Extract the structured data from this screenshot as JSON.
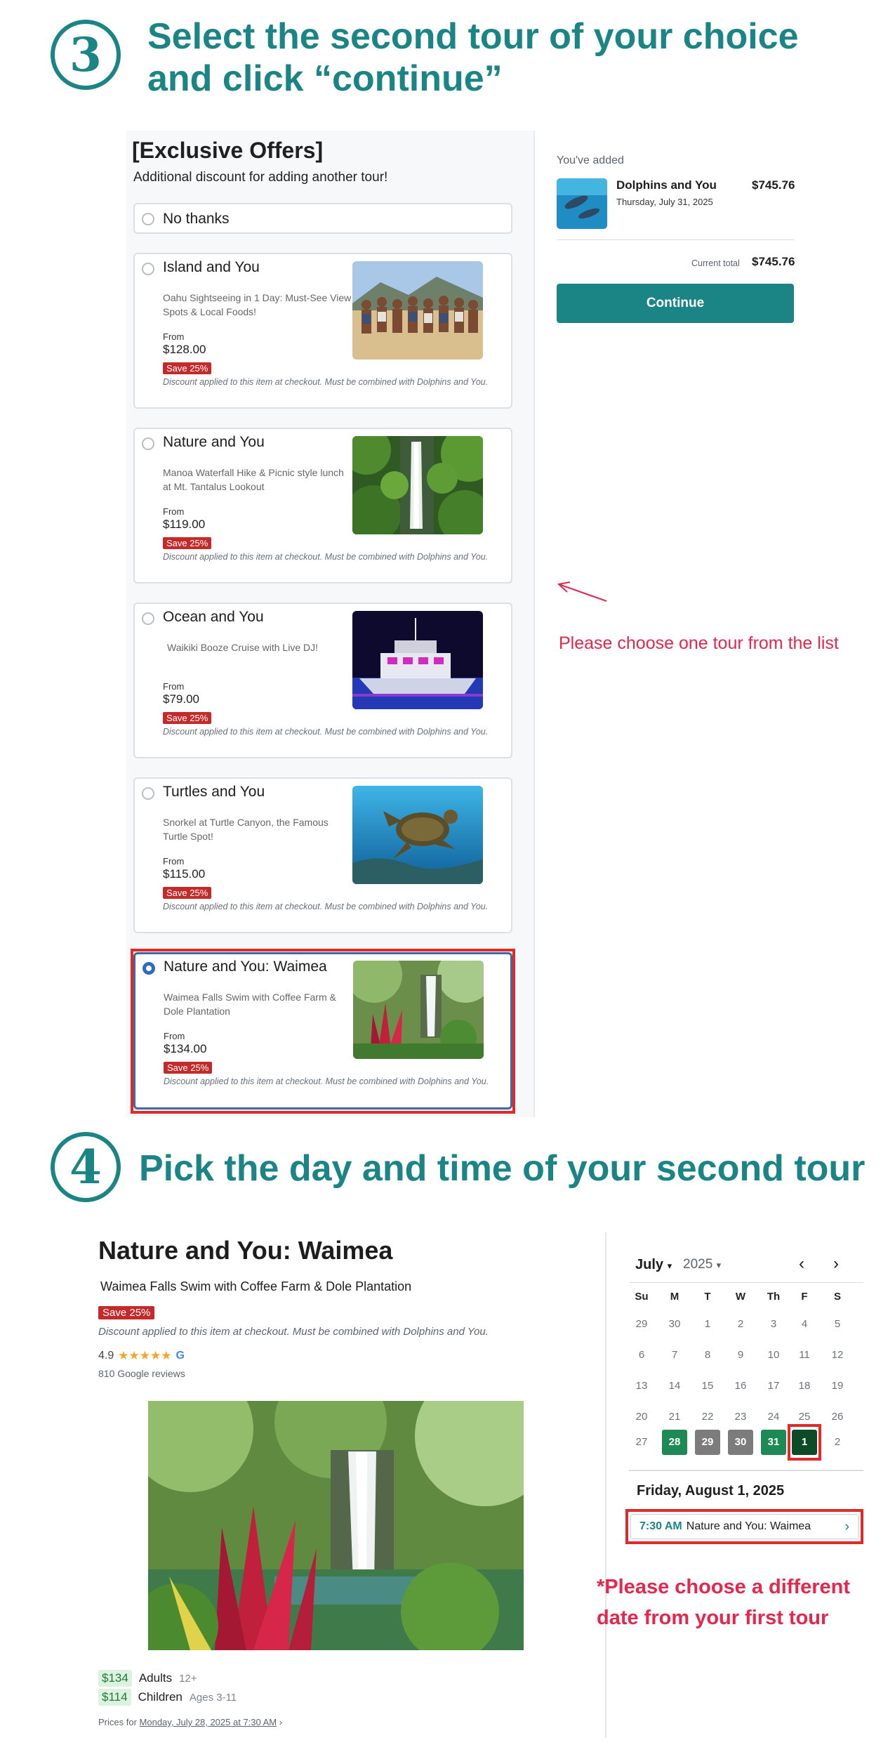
{
  "step3": {
    "number": "3",
    "title_line1": "Select the second tour of your choice",
    "title_line2": "and click “continue”"
  },
  "offers": {
    "heading": "[Exclusive Offers]",
    "subheading": "Additional discount for adding another tour!",
    "no_thanks": "No thanks",
    "options": [
      {
        "name": "Island and You",
        "desc": "Oahu Sightseeing in 1 Day: Must-See View Spots & Local Foods!",
        "from": "From",
        "price": "$128.00",
        "badge": "Save 25%",
        "note": "Discount applied to this item at checkout. Must be combined with Dolphins and You.",
        "selected": false
      },
      {
        "name": "Nature and You",
        "desc": "Manoa Waterfall Hike & Picnic style lunch at Mt. Tantalus Lookout",
        "from": "From",
        "price": "$119.00",
        "badge": "Save 25%",
        "note": "Discount applied to this item at checkout. Must be combined with Dolphins and You.",
        "selected": false
      },
      {
        "name": "Ocean and You",
        "desc": "Waikiki Booze Cruise with Live DJ!",
        "from": "From",
        "price": "$79.00",
        "badge": "Save 25%",
        "note": "Discount applied to this item at checkout. Must be combined with Dolphins and You.",
        "selected": false
      },
      {
        "name": "Turtles and You",
        "desc": "Snorkel at Turtle Canyon, the Famous Turtle Spot!",
        "from": "From",
        "price": "$115.00",
        "badge": "Save 25%",
        "note": "Discount applied to this item at checkout. Must be combined with Dolphins and You.",
        "selected": false
      },
      {
        "name": "Nature and You: Waimea",
        "desc": "Waimea Falls Swim with Coffee Farm & Dole Plantation",
        "from": "From",
        "price": "$134.00",
        "badge": "Save 25%",
        "note": "Discount applied to this item at checkout. Must be combined with Dolphins and You.",
        "selected": true
      }
    ]
  },
  "cart": {
    "label": "You've added",
    "item_name": "Dolphins and You",
    "item_date": "Thursday, July 31, 2025",
    "item_price": "$745.76",
    "total_label": "Current total",
    "total": "$745.76",
    "continue_label": "Continue",
    "hint": "Please choose one tour from the list"
  },
  "step4": {
    "number": "4",
    "title": "Pick the day and time of your second tour"
  },
  "tour": {
    "title": "Nature and You: Waimea",
    "subtitle": "Waimea Falls Swim with Coffee Farm & Dole Plantation",
    "badge": "Save 25%",
    "note": "Discount applied to this item at checkout. Must be combined with Dolphins and You.",
    "rating": "4.9",
    "stars": "★★★★★",
    "google_glyph": "G",
    "reviews": "810 Google reviews",
    "prices": [
      {
        "amount": "$134",
        "label": "Adults",
        "age": "12+"
      },
      {
        "amount": "$114",
        "label": "Children",
        "age": "Ages 3-11"
      }
    ],
    "prices_for_prefix": "Prices for",
    "prices_for_link": "Monday, July 28, 2025 at 7:30 AM",
    "prices_for_chevron": "›"
  },
  "calendar": {
    "month": "July",
    "year": "2025",
    "dropdown_glyph": "▾",
    "prev_glyph": "‹",
    "next_glyph": "›",
    "weekdays": [
      "Su",
      "M",
      "T",
      "W",
      "Th",
      "F",
      "S"
    ],
    "weeks": [
      [
        {
          "d": "29",
          "s": ""
        },
        {
          "d": "30",
          "s": ""
        },
        {
          "d": "1",
          "s": ""
        },
        {
          "d": "2",
          "s": ""
        },
        {
          "d": "3",
          "s": ""
        },
        {
          "d": "4",
          "s": ""
        },
        {
          "d": "5",
          "s": ""
        }
      ],
      [
        {
          "d": "6",
          "s": ""
        },
        {
          "d": "7",
          "s": ""
        },
        {
          "d": "8",
          "s": ""
        },
        {
          "d": "9",
          "s": ""
        },
        {
          "d": "10",
          "s": ""
        },
        {
          "d": "11",
          "s": ""
        },
        {
          "d": "12",
          "s": ""
        }
      ],
      [
        {
          "d": "13",
          "s": ""
        },
        {
          "d": "14",
          "s": ""
        },
        {
          "d": "15",
          "s": ""
        },
        {
          "d": "16",
          "s": ""
        },
        {
          "d": "17",
          "s": ""
        },
        {
          "d": "18",
          "s": ""
        },
        {
          "d": "19",
          "s": ""
        }
      ],
      [
        {
          "d": "20",
          "s": ""
        },
        {
          "d": "21",
          "s": ""
        },
        {
          "d": "22",
          "s": ""
        },
        {
          "d": "23",
          "s": ""
        },
        {
          "d": "24",
          "s": ""
        },
        {
          "d": "25",
          "s": ""
        },
        {
          "d": "26",
          "s": ""
        }
      ],
      [
        {
          "d": "27",
          "s": ""
        },
        {
          "d": "28",
          "s": "avail"
        },
        {
          "d": "29",
          "s": "gray"
        },
        {
          "d": "30",
          "s": "gray"
        },
        {
          "d": "31",
          "s": "avail"
        },
        {
          "d": "1",
          "s": "sel"
        },
        {
          "d": "2",
          "s": ""
        }
      ]
    ],
    "selected_date": "Friday, August 1, 2025",
    "slot_time": "7:30 AM",
    "slot_name": "Nature and You: Waimea",
    "slot_chevron": "›",
    "note": "*Please choose a different date from your first tour"
  },
  "colors": {
    "brand_teal": "#1b8585",
    "alert_red": "#e5264d",
    "save_badge": "#c42a2a",
    "available_day": "#1d8a55",
    "selected_day": "#0d4a27"
  }
}
